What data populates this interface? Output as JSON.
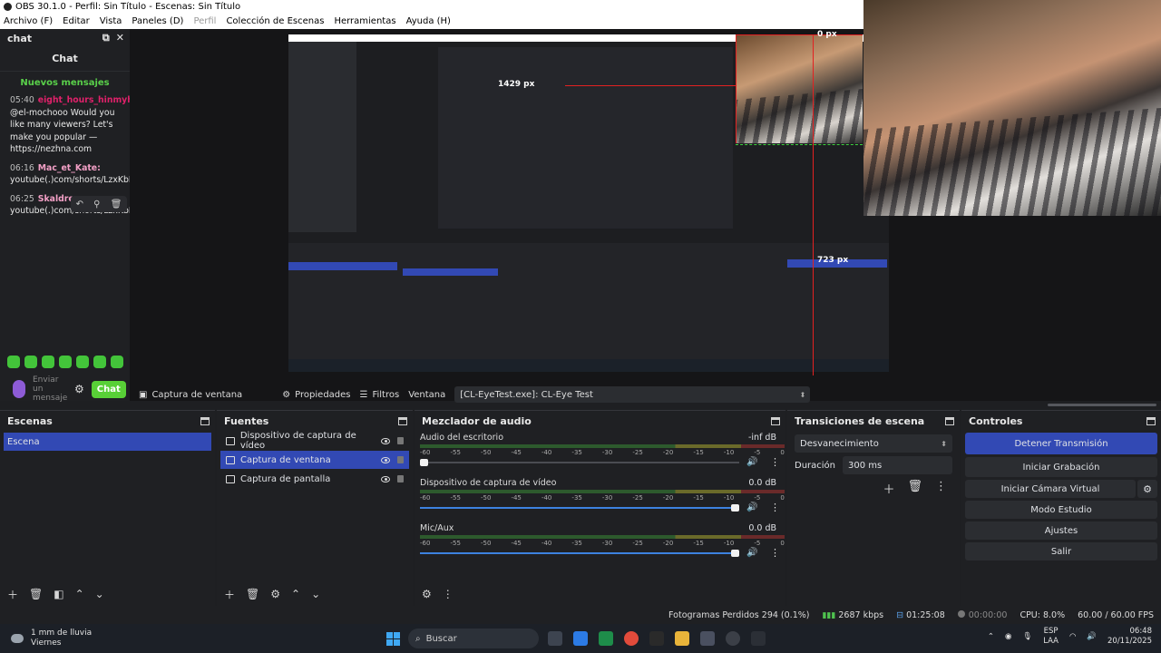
{
  "window": {
    "title": "OBS 30.1.0 - Perfil: Sin Título - Escenas: Sin Título"
  },
  "menu": {
    "items": [
      "Archivo (F)",
      "Editar",
      "Vista",
      "Paneles (D)",
      "Perfil",
      "Colección de Escenas",
      "Herramientas",
      "Ayuda (H)"
    ]
  },
  "chat": {
    "dock_title": "chat",
    "title": "Chat",
    "new_messages": "Nuevos mensajes",
    "messages": [
      {
        "time": "05:40",
        "user": "eight_hours_hinmyhe",
        "text": "@el-mochooo Would you like many viewers? Let's make you popular — https://nezhna.com"
      },
      {
        "time": "06:16",
        "user": "Mac_et_Kate:",
        "text": "youtube(.)com/shorts/LzxKbFcpAkc"
      },
      {
        "time": "06:25",
        "user": "Skaldrenox",
        "text": "youtube(.)com/shorts/LzxKbFcpAkc"
      }
    ],
    "input_placeholder": "Enviar un mensaje",
    "send_button": "Chat"
  },
  "preview": {
    "label_top": "0 px",
    "label_mid": "1429 px",
    "label_right": "723 px"
  },
  "source_toolbar": {
    "source_name": "Captura de ventana",
    "properties": "Propiedades",
    "filters": "Filtros",
    "window_label": "Ventana",
    "window_value": "[CL-EyeTest.exe]: CL-Eye Test"
  },
  "scenes": {
    "title": "Escenas",
    "items": [
      "Escena"
    ]
  },
  "sources": {
    "title": "Fuentes",
    "items": [
      "Dispositivo de captura de vídeo",
      "Captura de ventana",
      "Captura de pantalla"
    ]
  },
  "mixer": {
    "title": "Mezclador de audio",
    "ticks": [
      "-60",
      "-55",
      "-50",
      "-45",
      "-40",
      "-35",
      "-30",
      "-25",
      "-20",
      "-15",
      "-10",
      "-5",
      "0"
    ],
    "channels": [
      {
        "name": "Audio del escritorio",
        "db": "-inf dB",
        "level": 0.0
      },
      {
        "name": "Dispositivo de captura de vídeo",
        "db": "0.0 dB",
        "level": 1.0
      },
      {
        "name": "Mic/Aux",
        "db": "0.0 dB",
        "level": 1.0
      }
    ]
  },
  "transitions": {
    "title": "Transiciones de escena",
    "selected": "Desvanecimiento",
    "duration_label": "Duración",
    "duration_value": "300 ms"
  },
  "controls": {
    "title": "Controles",
    "stop_stream": "Detener Transmisión",
    "start_recording": "Iniciar Grabación",
    "start_virtual_cam": "Iniciar Cámara Virtual",
    "studio_mode": "Modo Estudio",
    "settings": "Ajustes",
    "exit": "Salir"
  },
  "status": {
    "dropped_frames": "Fotogramas Perdidos 294 (0.1%)",
    "bitrate": "2687 kbps",
    "stream_time": "01:25:08",
    "rec_time": "00:00:00",
    "cpu": "CPU: 8.0%",
    "fps": "60.00 / 60.00 FPS"
  },
  "taskbar": {
    "weather_line1": "1 mm de lluvia",
    "weather_line2": "Viernes",
    "search_placeholder": "Buscar",
    "lang_line1": "ESP",
    "lang_line2": "LAA",
    "time": "06:48",
    "date": "20/11/2025"
  },
  "colors": {
    "accent": "#3249b4",
    "chat_green": "#58d037",
    "guide_red": "#e32121"
  }
}
